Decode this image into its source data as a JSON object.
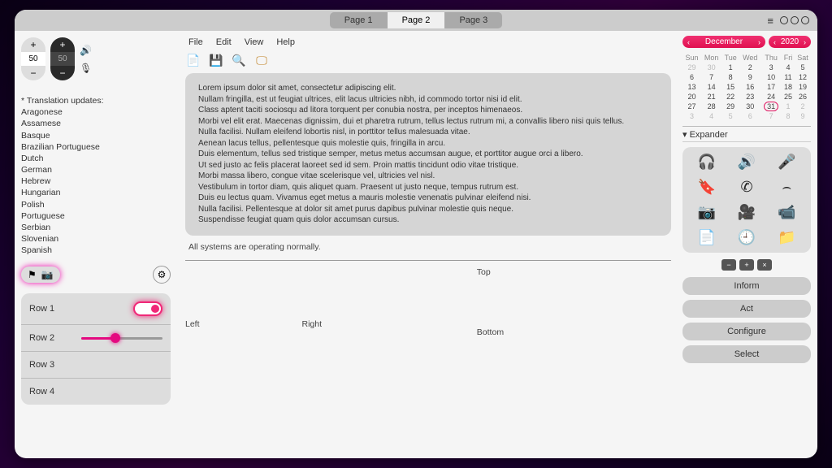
{
  "header": {
    "tabs": [
      "Page 1",
      "Page 2",
      "Page 3"
    ],
    "active_tab": 1
  },
  "left": {
    "stepper_light": "50",
    "stepper_dark": "50",
    "list_header": "* Translation updates:",
    "languages": [
      "Aragonese",
      "Assamese",
      "Basque",
      "Brazilian Portuguese",
      "Dutch",
      "German",
      "Hebrew",
      "Hungarian",
      "Polish",
      "Portuguese",
      "Serbian",
      "Slovenian",
      "Spanish"
    ],
    "rows": [
      "Row 1",
      "Row 2",
      "Row 3",
      "Row 4"
    ]
  },
  "center": {
    "menu": [
      "File",
      "Edit",
      "View",
      "Help"
    ],
    "lorem": [
      "Lorem ipsum dolor sit amet, consectetur adipiscing elit.",
      "Nullam fringilla, est ut feugiat ultrices, elit lacus ultricies nibh, id commodo tortor nisi id elit.",
      "Class aptent taciti sociosqu ad litora torquent per conubia nostra, per inceptos himenaeos.",
      "Morbi vel elit erat. Maecenas dignissim, dui et pharetra rutrum, tellus lectus rutrum mi, a convallis libero nisi quis tellus.",
      "Nulla facilisi. Nullam eleifend lobortis nisl, in porttitor tellus malesuada vitae.",
      "Aenean lacus tellus, pellentesque quis molestie quis, fringilla in arcu.",
      "Duis elementum, tellus sed tristique semper, metus metus accumsan augue, et porttitor augue orci a libero.",
      "Ut sed justo ac felis placerat laoreet sed id sem. Proin mattis tincidunt odio vitae tristique.",
      "Morbi massa libero, congue vitae scelerisque vel, ultricies vel nisl.",
      "Vestibulum in tortor diam, quis aliquet quam. Praesent ut justo neque, tempus rutrum est.",
      "Duis eu lectus quam. Vivamus eget metus a mauris molestie venenatis pulvinar eleifend nisi.",
      "Nulla facilisi. Pellentesque at dolor sit amet purus dapibus pulvinar molestie quis neque.",
      "Suspendisse feugiat quam quis dolor accumsan cursus."
    ],
    "status": "All systems are operating normally.",
    "pos": {
      "top": "Top",
      "left": "Left",
      "right": "Right",
      "bottom": "Bottom"
    }
  },
  "calendar": {
    "month": "December",
    "year": "2020",
    "days": [
      "Sun",
      "Mon",
      "Tue",
      "Wed",
      "Thu",
      "Fri",
      "Sat"
    ],
    "weeks": [
      [
        {
          "n": "29",
          "dim": true
        },
        {
          "n": "30",
          "dim": true
        },
        {
          "n": "1"
        },
        {
          "n": "2"
        },
        {
          "n": "3"
        },
        {
          "n": "4"
        },
        {
          "n": "5"
        }
      ],
      [
        {
          "n": "6"
        },
        {
          "n": "7"
        },
        {
          "n": "8"
        },
        {
          "n": "9"
        },
        {
          "n": "10"
        },
        {
          "n": "11"
        },
        {
          "n": "12"
        }
      ],
      [
        {
          "n": "13"
        },
        {
          "n": "14"
        },
        {
          "n": "15"
        },
        {
          "n": "16"
        },
        {
          "n": "17"
        },
        {
          "n": "18"
        },
        {
          "n": "19"
        }
      ],
      [
        {
          "n": "20"
        },
        {
          "n": "21"
        },
        {
          "n": "22"
        },
        {
          "n": "23"
        },
        {
          "n": "24"
        },
        {
          "n": "25"
        },
        {
          "n": "26"
        }
      ],
      [
        {
          "n": "27"
        },
        {
          "n": "28"
        },
        {
          "n": "29"
        },
        {
          "n": "30"
        },
        {
          "n": "31",
          "sel": true
        },
        {
          "n": "1",
          "dim": true
        },
        {
          "n": "2",
          "dim": true
        }
      ],
      [
        {
          "n": "3",
          "dim": true
        },
        {
          "n": "4",
          "dim": true
        },
        {
          "n": "5",
          "dim": true
        },
        {
          "n": "6",
          "dim": true
        },
        {
          "n": "7",
          "dim": true
        },
        {
          "n": "8",
          "dim": true
        },
        {
          "n": "9",
          "dim": true
        }
      ]
    ]
  },
  "expander_label": "Expander",
  "actions": [
    "Inform",
    "Act",
    "Configure",
    "Select"
  ],
  "icons": {
    "flag": "⚑",
    "camera": "📷",
    "gear": "⚙",
    "doc": "📄",
    "save": "💾",
    "search": "🔍",
    "screen": "🖵",
    "headphones": "🎧",
    "speaker": "🔊",
    "mic": "🎤",
    "bookmark": "🔖",
    "phone": "✆",
    "hangup": "⌢",
    "photo": "📷",
    "video": "🎥",
    "cam": "📹",
    "newdoc": "📄",
    "clock": "🕘",
    "folder": "📁",
    "minus": "−",
    "plus": "+",
    "x": "×",
    "volume": "🔊",
    "mic2": "🎙",
    "hamburger": "≡"
  }
}
